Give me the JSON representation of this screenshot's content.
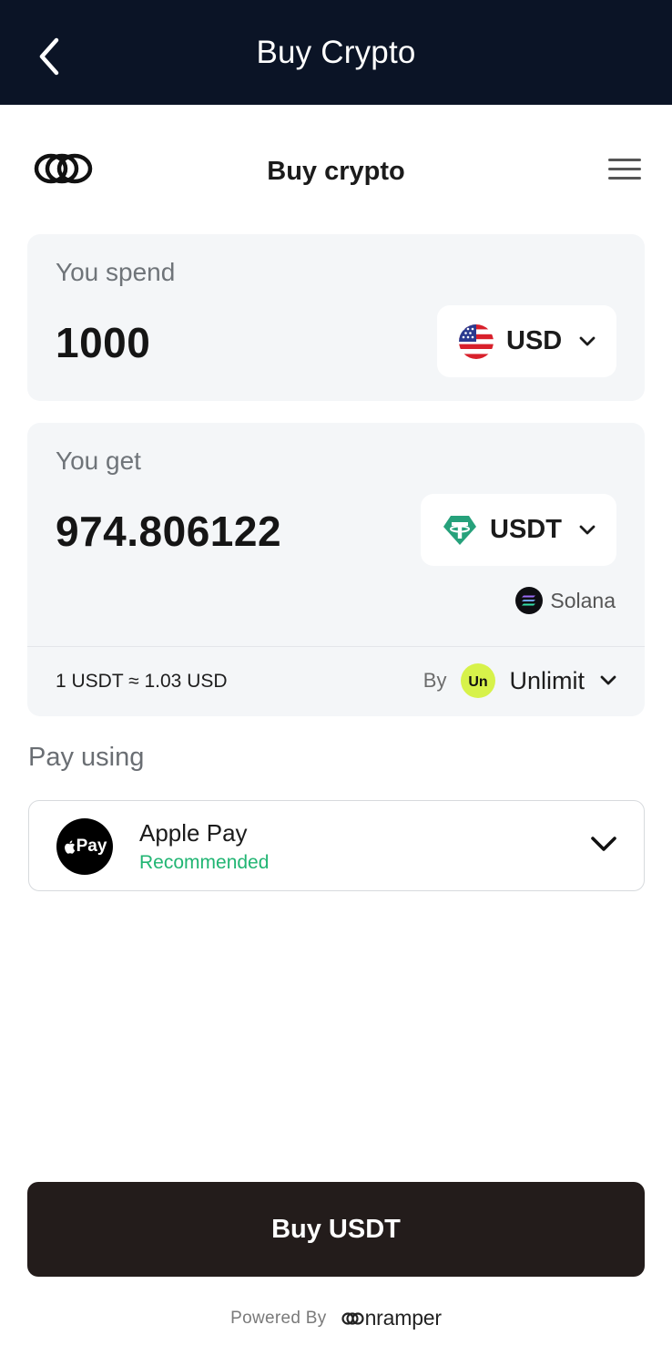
{
  "header": {
    "title": "Buy Crypto",
    "back_icon": "chevron-left-icon"
  },
  "widget": {
    "title": "Buy crypto",
    "logo_icon": "onramper-logo-icon",
    "menu_icon": "hamburger-menu-icon"
  },
  "spend": {
    "label": "You spend",
    "amount": "1000",
    "currency": "USD",
    "flag_icon": "us-flag-icon"
  },
  "get": {
    "label": "You get",
    "amount": "974.806122",
    "currency": "USDT",
    "token_icon": "tether-icon",
    "network": "Solana",
    "network_icon": "solana-icon"
  },
  "quote": {
    "rate": "1 USDT ≈ 1.03 USD",
    "by_label": "By",
    "provider": "Unlimit",
    "provider_logo_text": "Un"
  },
  "payment": {
    "label": "Pay using",
    "method": "Apple Pay",
    "badge": "Recommended",
    "icon_text": "Pay"
  },
  "cta": {
    "label": "Buy USDT"
  },
  "footer": {
    "powered_by": "Powered By",
    "brand": "nramper"
  },
  "colors": {
    "header_bg": "#0b1426",
    "card_bg": "#f4f6f8",
    "cta_bg": "#231c1b",
    "recommended": "#21b573",
    "tether": "#26a17b",
    "unlimit": "#d7f24a"
  }
}
